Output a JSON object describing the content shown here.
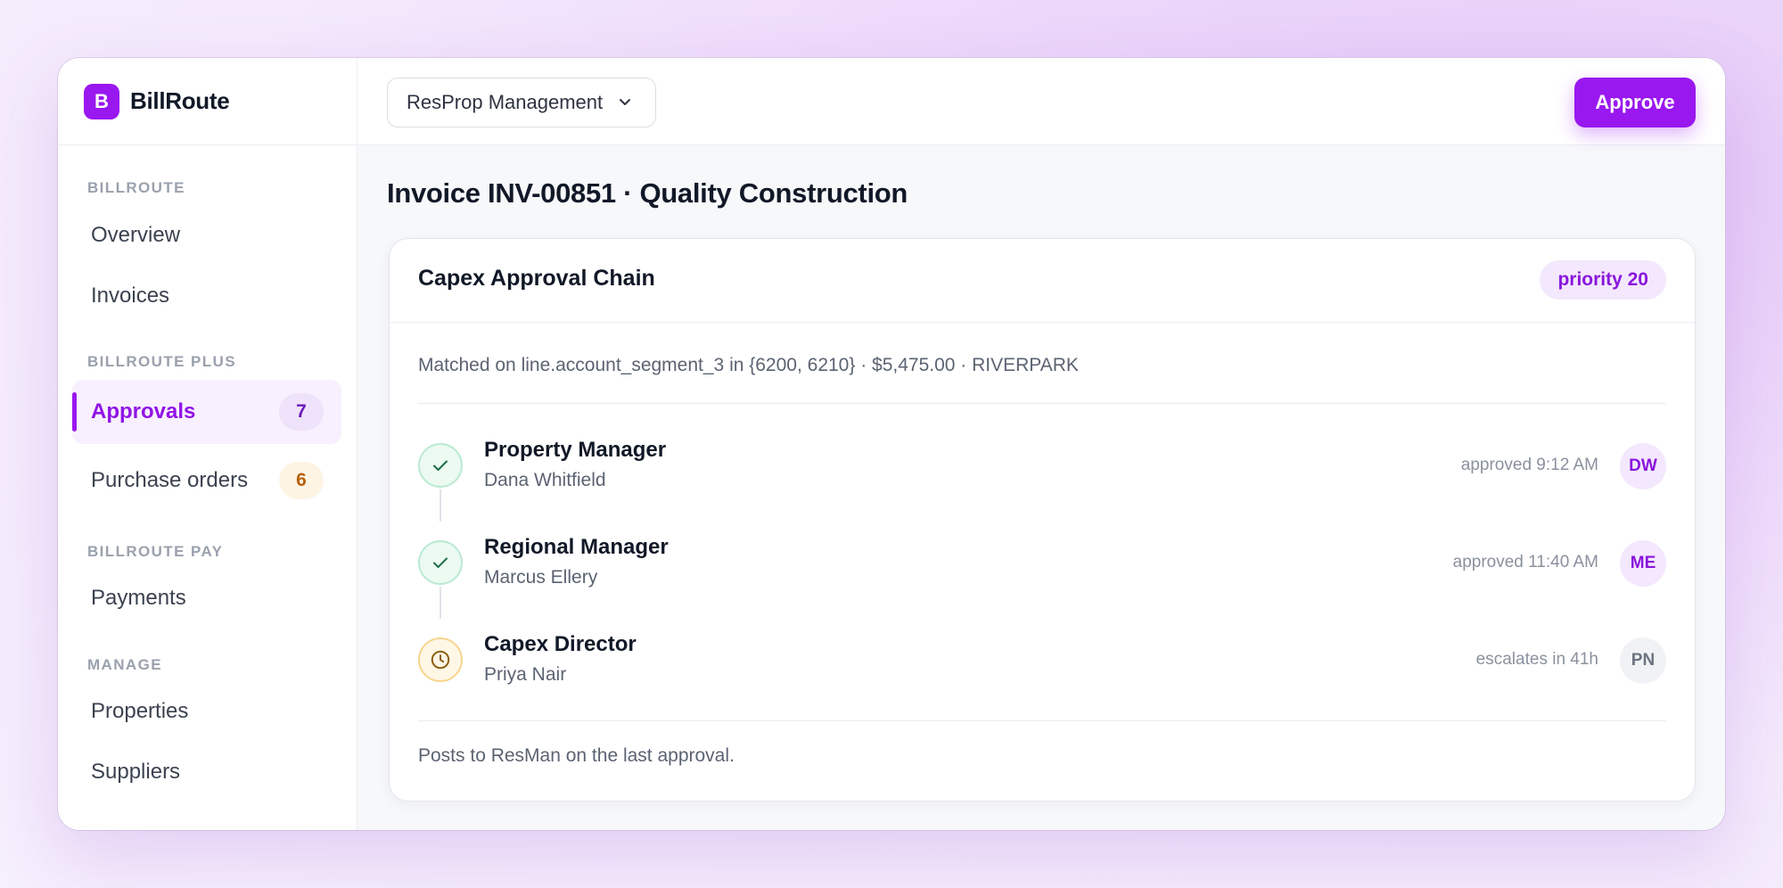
{
  "brand": {
    "logo_letter": "B",
    "name": "BillRoute"
  },
  "sidebar": {
    "sections": [
      {
        "label": "BILLROUTE"
      },
      {
        "label": "BILLROUTE PLUS"
      },
      {
        "label": "BILLROUTE PAY"
      },
      {
        "label": "MANAGE"
      }
    ],
    "items": [
      {
        "label": "Overview"
      },
      {
        "label": "Invoices"
      },
      {
        "label": "Approvals",
        "badge": "7",
        "active": true
      },
      {
        "label": "Purchase orders",
        "badge": "6"
      },
      {
        "label": "Payments"
      },
      {
        "label": "Properties"
      },
      {
        "label": "Suppliers"
      }
    ]
  },
  "topbar": {
    "org_select": "ResProp Management",
    "approve_label": "Approve"
  },
  "page": {
    "title": "Invoice INV-00851 · Quality Construction"
  },
  "card": {
    "title": "Capex Approval Chain",
    "priority": "priority 20",
    "match_line": "Matched on line.account_segment_3 in {6200, 6210} · $5,475.00 · RIVERPARK",
    "steps": [
      {
        "role": "Property Manager",
        "person": "Dana Whitfield",
        "status": "approved 9:12 AM",
        "initials": "DW",
        "state": "approved",
        "icon": "check-icon"
      },
      {
        "role": "Regional Manager",
        "person": "Marcus Ellery",
        "status": "approved 11:40 AM",
        "initials": "ME",
        "state": "approved",
        "icon": "check-icon"
      },
      {
        "role": "Capex Director",
        "person": "Priya Nair",
        "status": "escalates in 41h",
        "initials": "PN",
        "state": "pending",
        "icon": "clock-icon"
      }
    ],
    "footnote": "Posts to ResMan on the last approval."
  },
  "colors": {
    "accent": "#9a18f0",
    "approved": "#2f9e63",
    "pending": "#d9900f"
  }
}
